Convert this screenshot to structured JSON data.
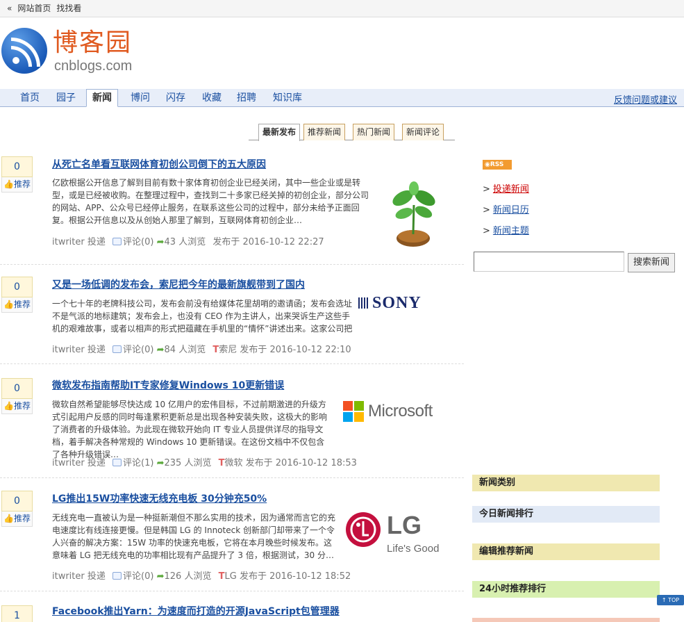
{
  "topbar": {
    "back": "«",
    "home": "网站首页",
    "find": "找找看"
  },
  "logo": {
    "cn": "博客园",
    "en": "cnblogs.com"
  },
  "nav": {
    "items": [
      "首页",
      "园子",
      "新闻",
      "博问",
      "闪存",
      "收藏",
      "招聘",
      "知识库"
    ],
    "active": "新闻",
    "feedback": "反馈问题或建议"
  },
  "tabs": [
    "最新发布",
    "推荐新闻",
    "热门新闻",
    "新闻评论"
  ],
  "news": [
    {
      "count": "0",
      "digg": "推荐",
      "title": "从死亡名单看互联网体育初创公司倒下的五大原因",
      "summary": "亿欧根据公开信息了解到目前有数十家体育初创企业已经关闭，其中一些企业或是转型，或是已经被收购。在整理过程中，查找到二十多家已经关掉的初创企业，部分公司的网站、APP、公众号已经停止服务，在联系这些公司的过程中，部分未给予正面回复。根据公开信息以及从创始人那里了解到，互联网体育初创企业…",
      "author": "itwriter",
      "post_label": "投递",
      "comments": "评论(0)",
      "views": "43 人浏览",
      "tag": "",
      "time": "发布于 2016-10-12 22:27",
      "thumb": "plant"
    },
    {
      "count": "0",
      "digg": "推荐",
      "title": "又是一场低调的发布会，索尼把今年的最新旗舰带到了国内",
      "summary": "一个七十年的老牌科技公司，发布会前没有给媒体花里胡哨的邀请函；发布会选址不是气派的地标建筑；发布会上，也没有 CEO 作为主讲人，出来哭诉生产这些手机的艰难故事，或者以相声的形式把蕴藏在手机里的“情怀”讲述出来。这家公司把发布会开成了一堂物理课，影像工程师上台…",
      "author": "itwriter",
      "post_label": "投递",
      "comments": "评论(0)",
      "views": "84 人浏览",
      "tag": "索尼",
      "time": "发布于 2016-10-12 22:10",
      "thumb": "SONY"
    },
    {
      "count": "0",
      "digg": "推荐",
      "title": "微软发布指南帮助IT专家修复Windows 10更新错误",
      "summary": "微软自然希望能够尽快达成 10 亿用户的宏伟目标，不过前期激进的升级方式引起用户反感的同时每逢累积更新总是出现各种安装失败，这极大的影响了消费者的升级体验。为此现在微软开始向 IT 专业人员提供详尽的指导文档，着手解决各种常规的 Windows 10 更新错误。在这份文档中不仅包含了各种升级错误…",
      "author": "itwriter",
      "post_label": "投递",
      "comments": "评论(1)",
      "views": "235 人浏览",
      "tag": "微软",
      "time": "发布于 2016-10-12 18:53",
      "thumb": "Microsoft"
    },
    {
      "count": "0",
      "digg": "推荐",
      "title": "LG推出15W功率快速无线充电板 30分钟充50%",
      "summary": "无线充电一直被认为是一种挺新潮但不那么实用的技术，因为通常而言它的充电速度比有线连接更慢。但是韩国 LG 的 Innoteck 创新部门却带来了一个令人兴奋的解决方案：15W 功率的快速充电板，它将在本月晚些时候发布。这意味着 LG 把无线充电的功率相比现有产品提升了 3 倍，根据测试，30 分…",
      "author": "itwriter",
      "post_label": "投递",
      "comments": "评论(0)",
      "views": "126 人浏览",
      "tag": "LG",
      "time": "发布于 2016-10-12 18:52",
      "thumb": "LG"
    },
    {
      "count": "1",
      "digg": "",
      "title": "Facebook推出Yarn：为速度而打造的开源JavaScript包管理器"
    }
  ],
  "thumbs": {
    "lg_slogan": "Life's Good"
  },
  "sidebar": {
    "rss": "RSS",
    "links": [
      "投递新闻",
      "新闻日历",
      "新闻主题"
    ],
    "search_button": "搜索新闻",
    "boxes": [
      {
        "label": "新闻类别",
        "color": "#f0e8b0"
      },
      {
        "label": "今日新闻排行",
        "color": "#e2eaf6"
      },
      {
        "label": "编辑推荐新闻",
        "color": "#f0e8b0"
      },
      {
        "label": "24小时推荐排行",
        "color": "#d8f0b0"
      }
    ]
  },
  "totop": "↑ TOP"
}
